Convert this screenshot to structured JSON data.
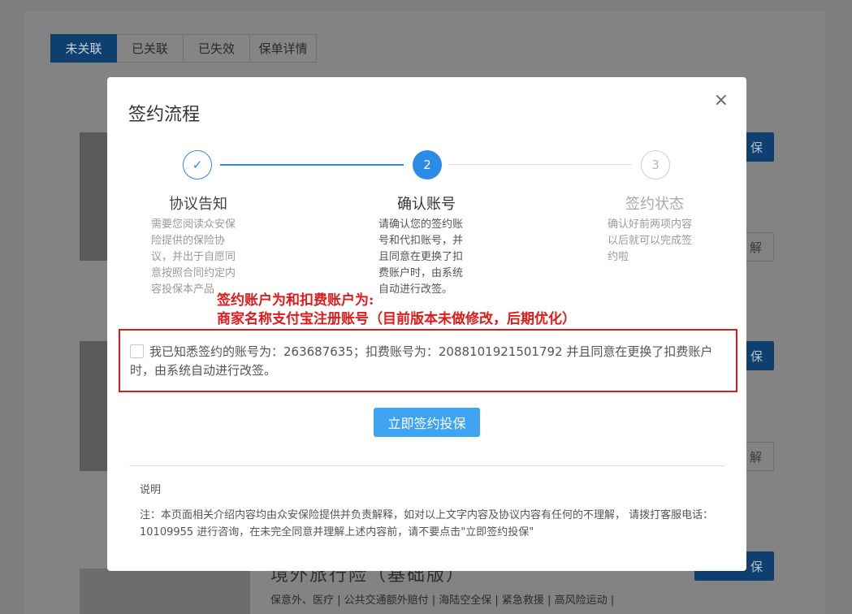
{
  "background": {
    "tabs": [
      "未关联",
      "已关联",
      "已失效",
      "保单详情"
    ],
    "button_text_1": "保",
    "button_text_2": "解",
    "button_text_3": "保",
    "button_text_4": "解",
    "button_text_5": "保",
    "product_title": "境外旅行险（基础版）",
    "product_tags": "保意外、医疗 | 公共交通额外赔付 | 海陆空全保 | 紧急救援 | 高风险运动 |"
  },
  "modal": {
    "title": "签约流程",
    "close_icon": "×",
    "steps": [
      {
        "marker": "✓",
        "name": "协议告知",
        "desc": "需要您阅读众安保险提供的保险协议，并出于自愿同意按照合同约定内容投保本产品"
      },
      {
        "marker": "2",
        "name": "确认账号",
        "desc": "请确认您的签约账号和代扣账号，并且同意在更换了扣费账户时，由系统自动进行改签。"
      },
      {
        "marker": "3",
        "name": "签约状态",
        "desc": "确认好前两项内容以后就可以完成签约啦"
      }
    ],
    "annotation_line1": "签约账户为和扣费账户为:",
    "annotation_line2": "商家名称支付宝注册账号（目前版本未做修改，后期优化）",
    "agree_text": "我已知悉签约的账号为：263687635；扣费账号为：2088101921501792 并且同意在更换了扣费账户时，由系统自动进行改签。",
    "submit_label": "立即签约投保",
    "note_title": "说明",
    "note_text": "注：本页面相关介绍内容均由众安保险提供并负责解释，如对以上文字内容及协议内容有任何的不理解， 请拨打客服电话：10109955 进行咨询，在未完全同意并理解上述内容前，请不要点击\"立即签约投保\""
  },
  "colors": {
    "accent": "#2c8ae8",
    "button": "#3ea4f2",
    "annotation": "#e21a1a"
  }
}
